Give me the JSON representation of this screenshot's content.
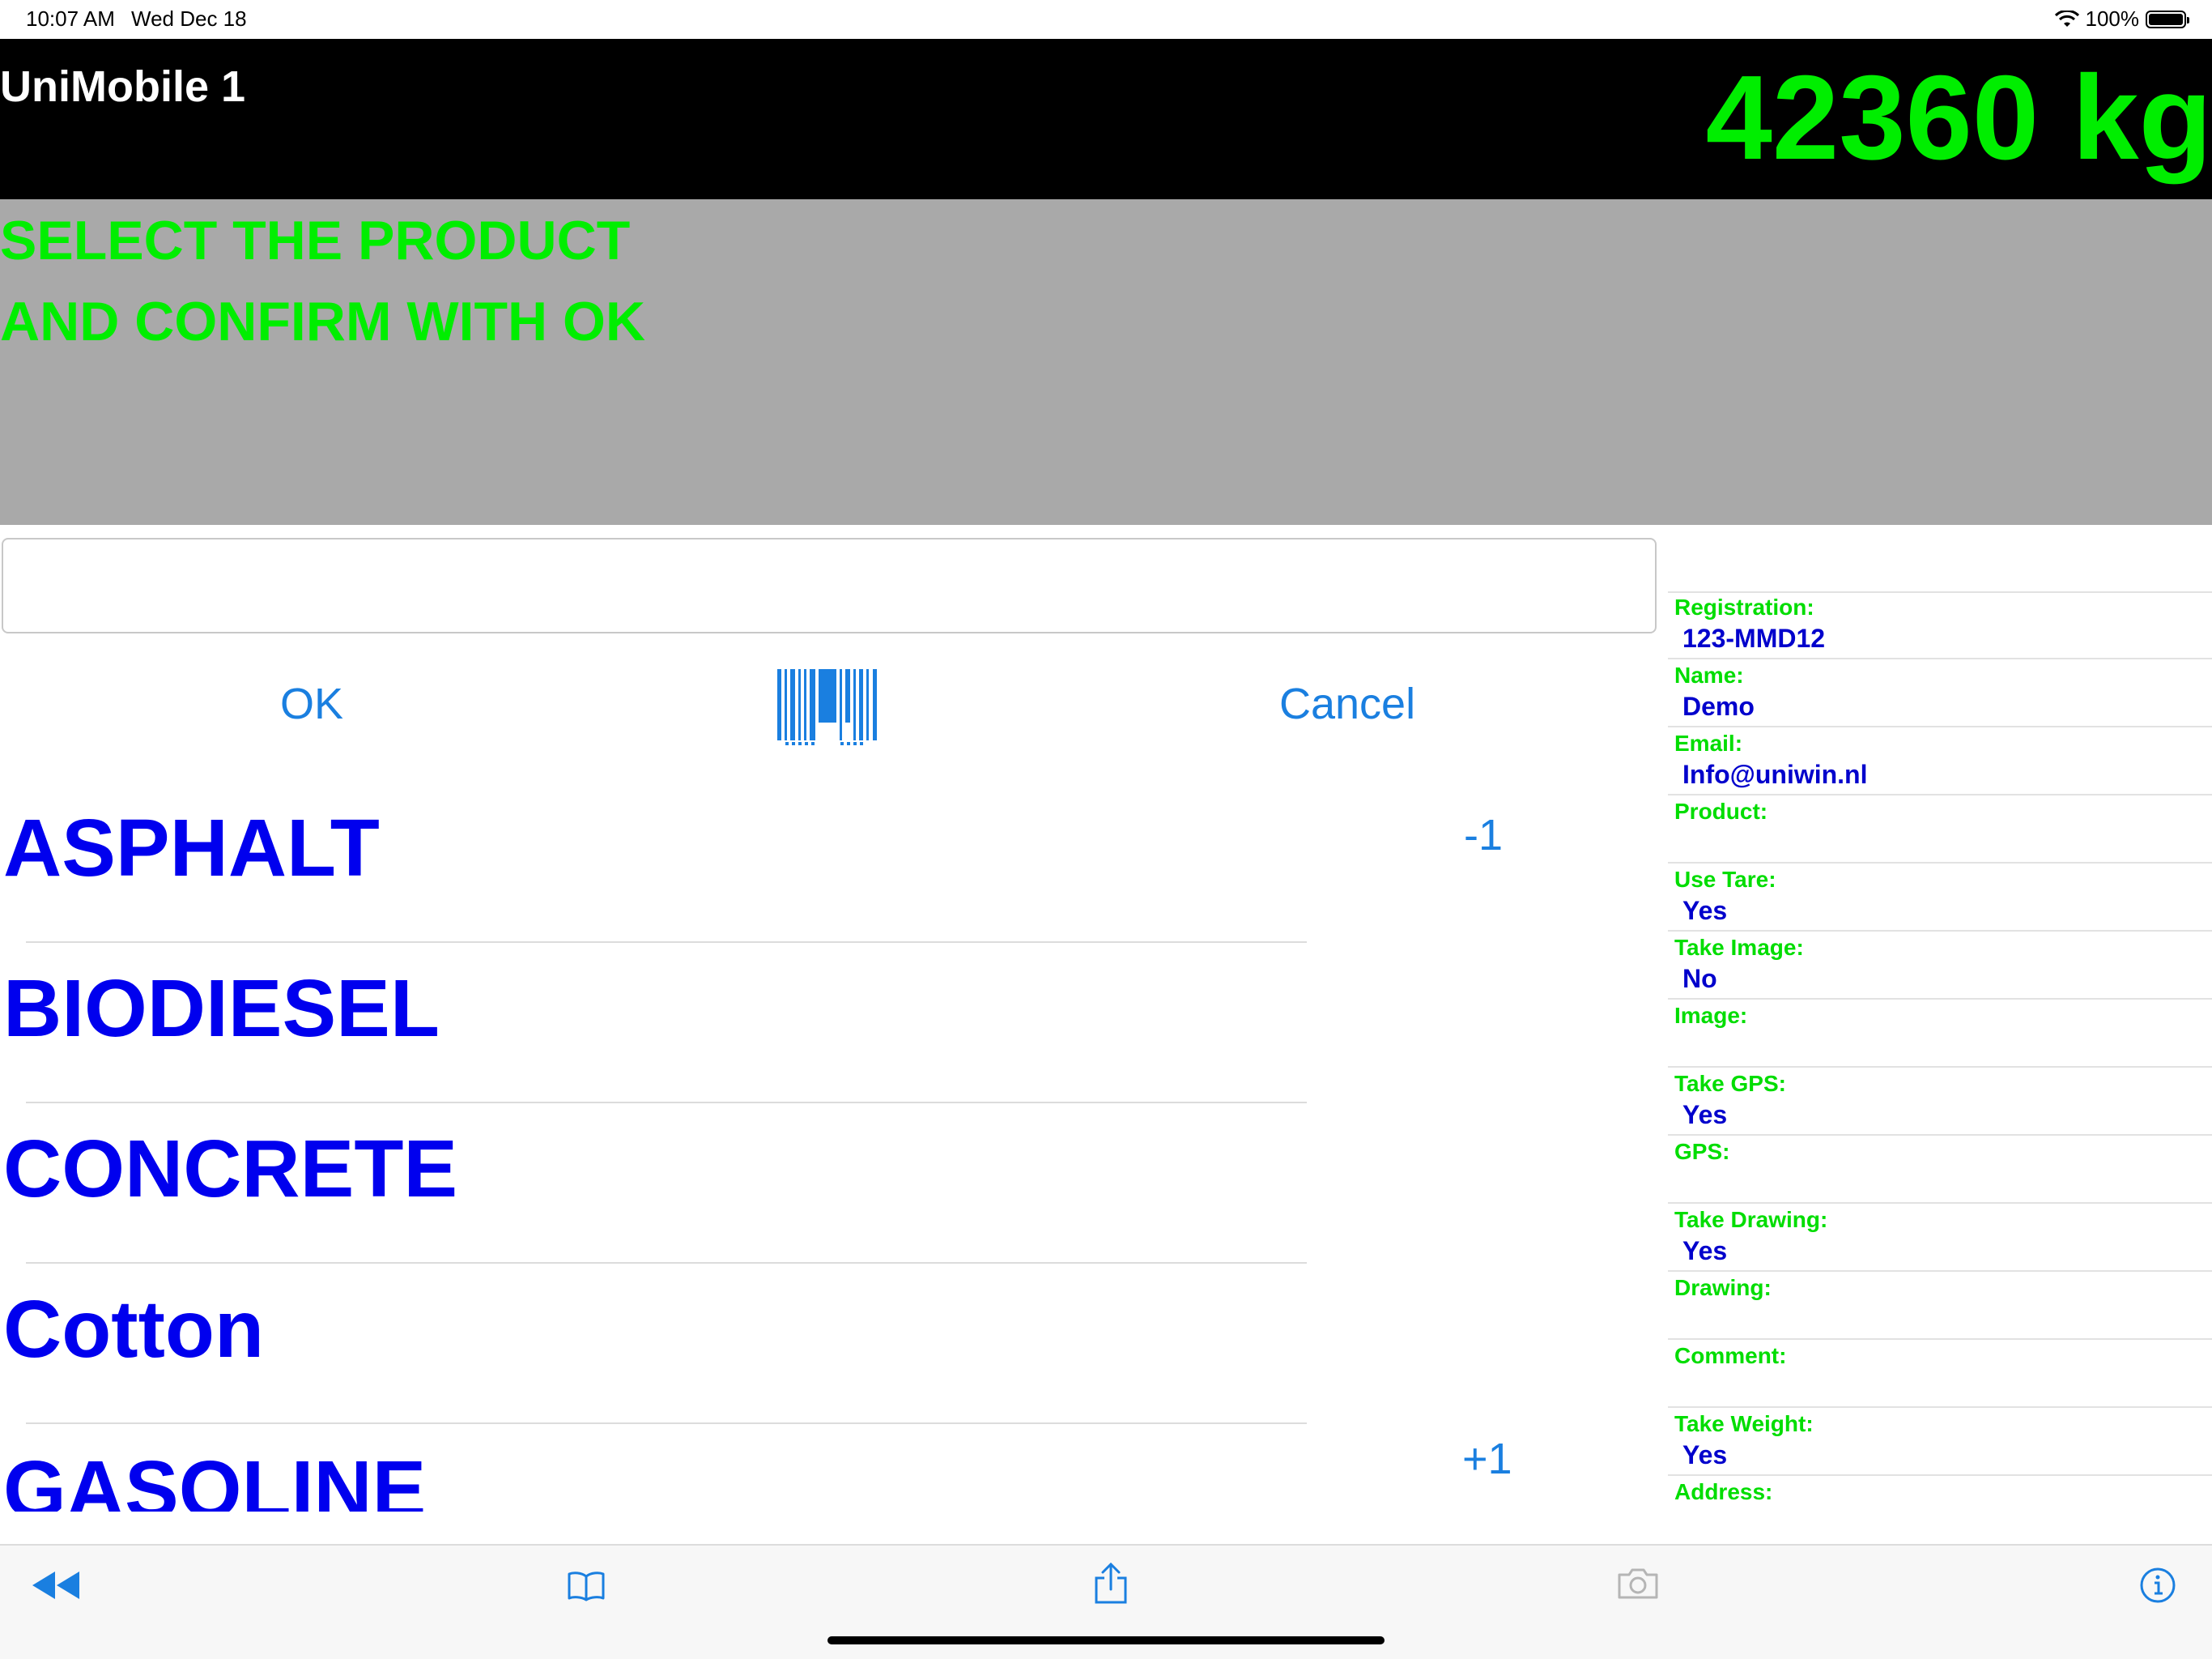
{
  "status_bar": {
    "time": "10:07 AM",
    "date": "Wed Dec 18",
    "battery": "100%"
  },
  "header": {
    "title": "UniMobile 1",
    "weight": "42360 kg"
  },
  "message": {
    "line1": "SELECT THE PRODUCT",
    "line2": "AND CONFIRM WITH OK"
  },
  "search": {
    "value": "",
    "placeholder": ""
  },
  "buttons": {
    "ok": "OK",
    "cancel": "Cancel"
  },
  "products": [
    "ASPHALT",
    "BIODIESEL",
    "CONCRETE",
    "Cotton",
    "GASOLINE"
  ],
  "badges": {
    "minus": "-1",
    "plus": "+1"
  },
  "details": [
    {
      "label": "Registration:",
      "value": "123-MMD12"
    },
    {
      "label": "Name:",
      "value": "Demo"
    },
    {
      "label": "Email:",
      "value": "Info@uniwin.nl"
    },
    {
      "label": "Product:",
      "value": ""
    },
    {
      "label": "Use Tare:",
      "value": "Yes"
    },
    {
      "label": "Take Image:",
      "value": "No"
    },
    {
      "label": "Image:",
      "value": ""
    },
    {
      "label": "Take GPS:",
      "value": "Yes"
    },
    {
      "label": "GPS:",
      "value": ""
    },
    {
      "label": "Take Drawing:",
      "value": "Yes"
    },
    {
      "label": "Drawing:",
      "value": ""
    },
    {
      "label": "Comment:",
      "value": ""
    },
    {
      "label": "Take Weight:",
      "value": "Yes"
    },
    {
      "label": "Address:",
      "value": ""
    }
  ],
  "toolbar_icons": [
    "rewind-icon",
    "book-icon",
    "share-icon",
    "camera-icon",
    "info-icon"
  ],
  "colors": {
    "accent_blue": "#1a7fe0",
    "product_blue": "#0000ee",
    "green": "#00ee00",
    "message_bg": "#a9a9a9"
  }
}
